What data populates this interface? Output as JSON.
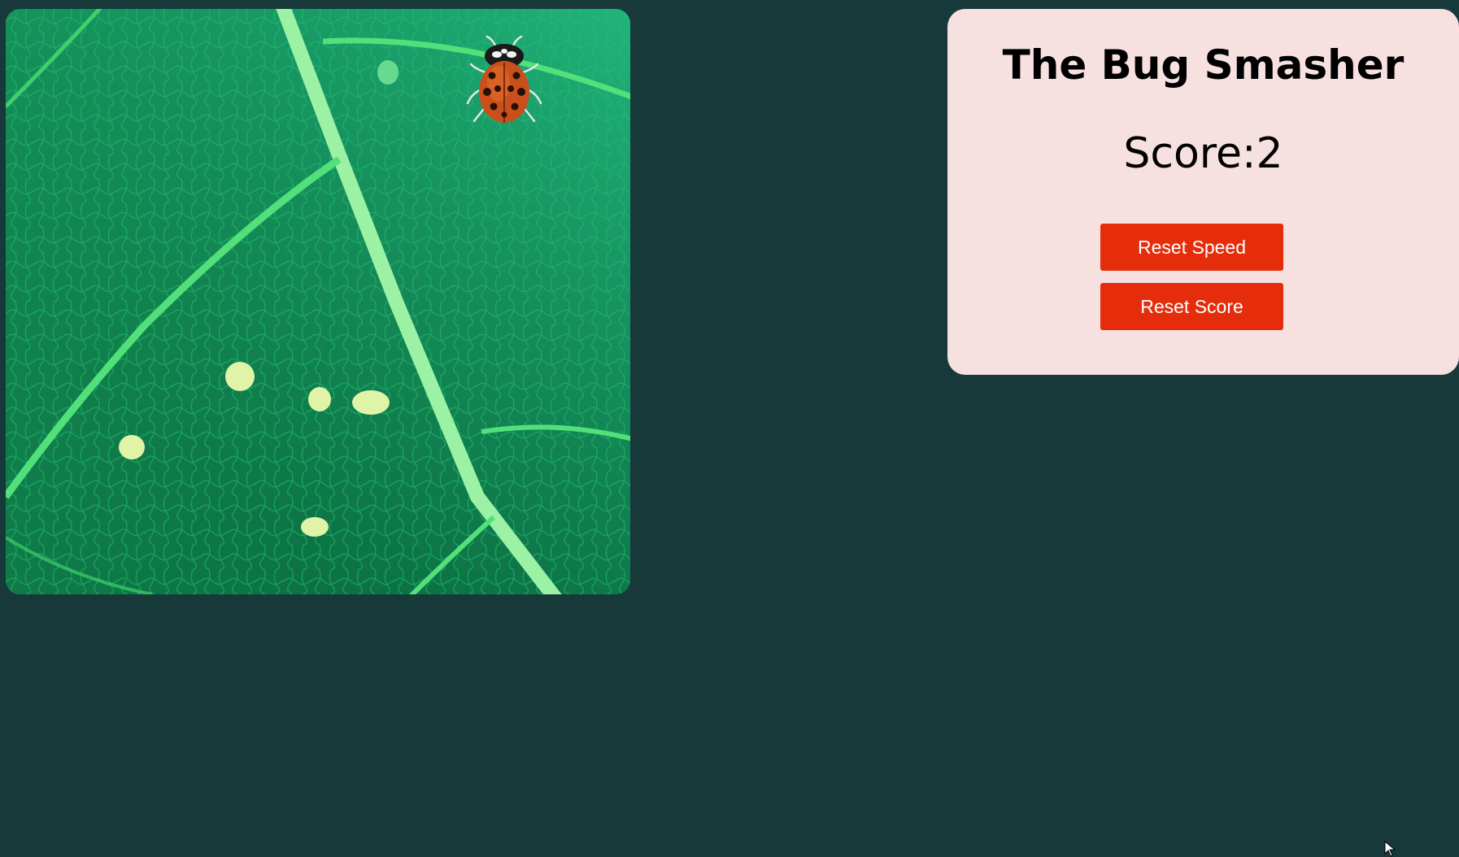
{
  "game": {
    "background_color": "#17393a",
    "board_image": "leaf-texture",
    "bug_icon": "ladybug-icon"
  },
  "panel": {
    "title": "The Bug Smasher",
    "score_label": "Score:",
    "score_value": "2",
    "reset_speed_label": "Reset Speed",
    "reset_score_label": "Reset Score",
    "background_color": "#f6e0e0",
    "button_color": "#e52d0b"
  }
}
